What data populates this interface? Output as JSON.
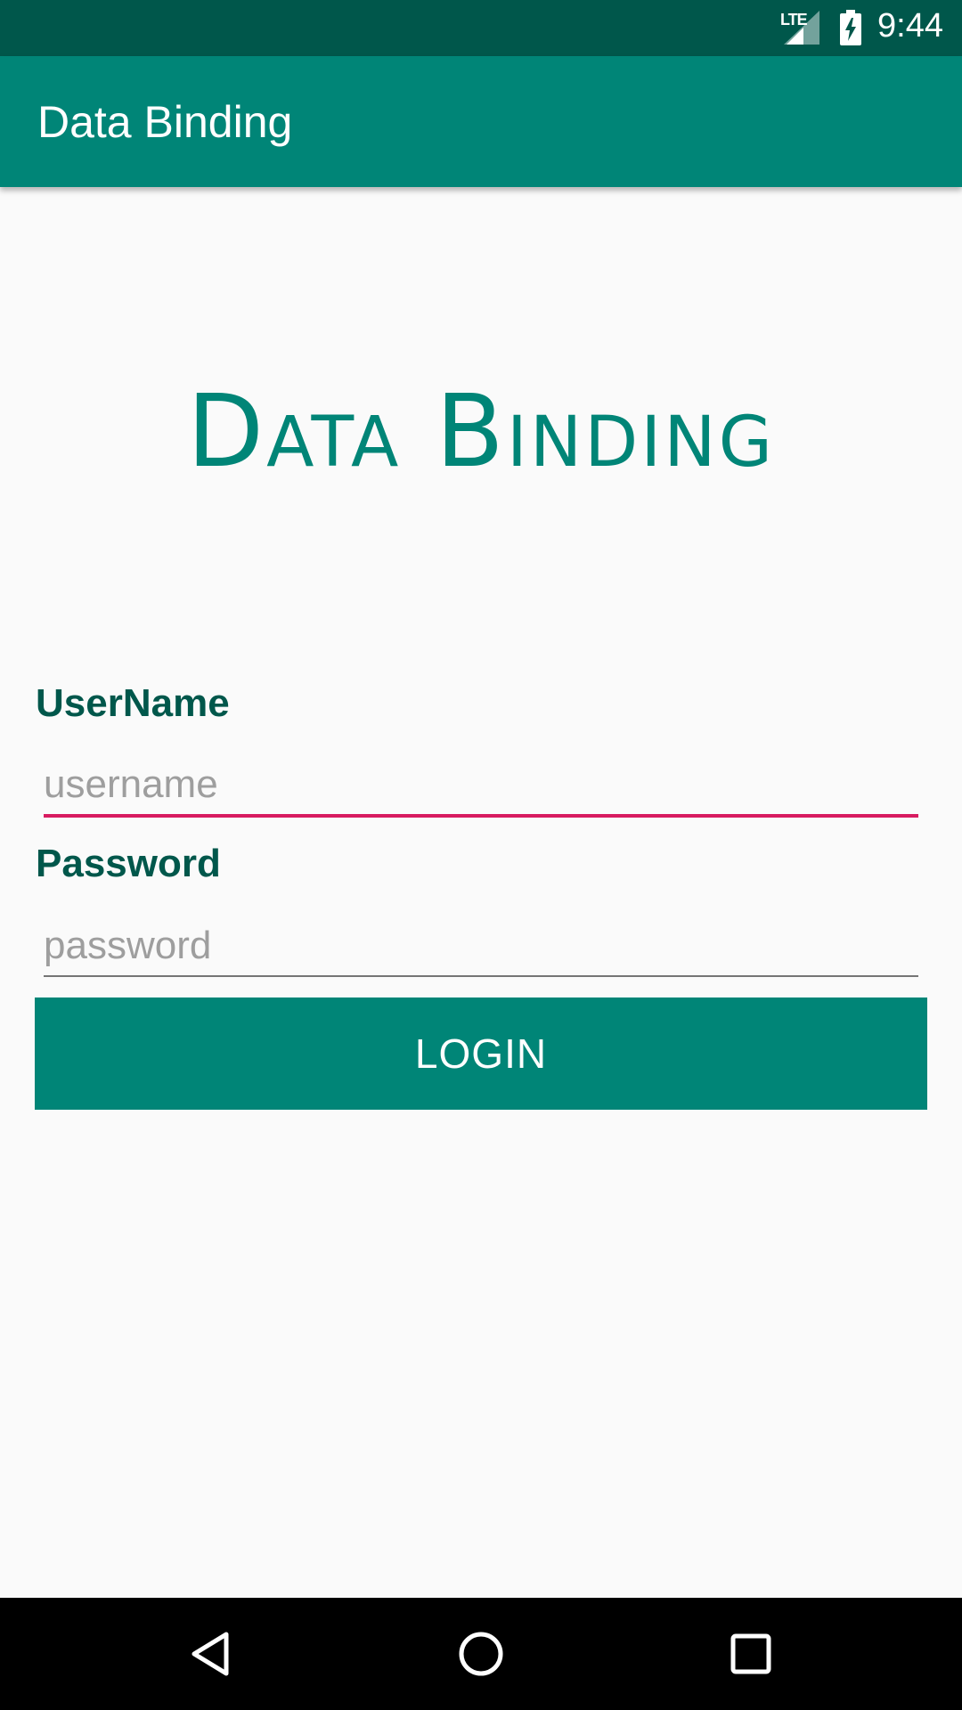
{
  "status_bar": {
    "network": "LTE",
    "time": "9:44"
  },
  "app_bar": {
    "title": "Data Binding"
  },
  "hero": {
    "title": "Data Binding"
  },
  "form": {
    "username_label": "UserName",
    "username_placeholder": "username",
    "username_value": "",
    "password_label": "Password",
    "password_placeholder": "password",
    "password_value": "",
    "login_label": "LOGIN"
  },
  "nav_bar": {
    "icons": [
      "back-icon",
      "home-icon",
      "recents-icon"
    ]
  },
  "colors": {
    "primary": "#008577",
    "primary_dark": "#00574b",
    "accent": "#d81b60",
    "background": "#fafafa"
  }
}
